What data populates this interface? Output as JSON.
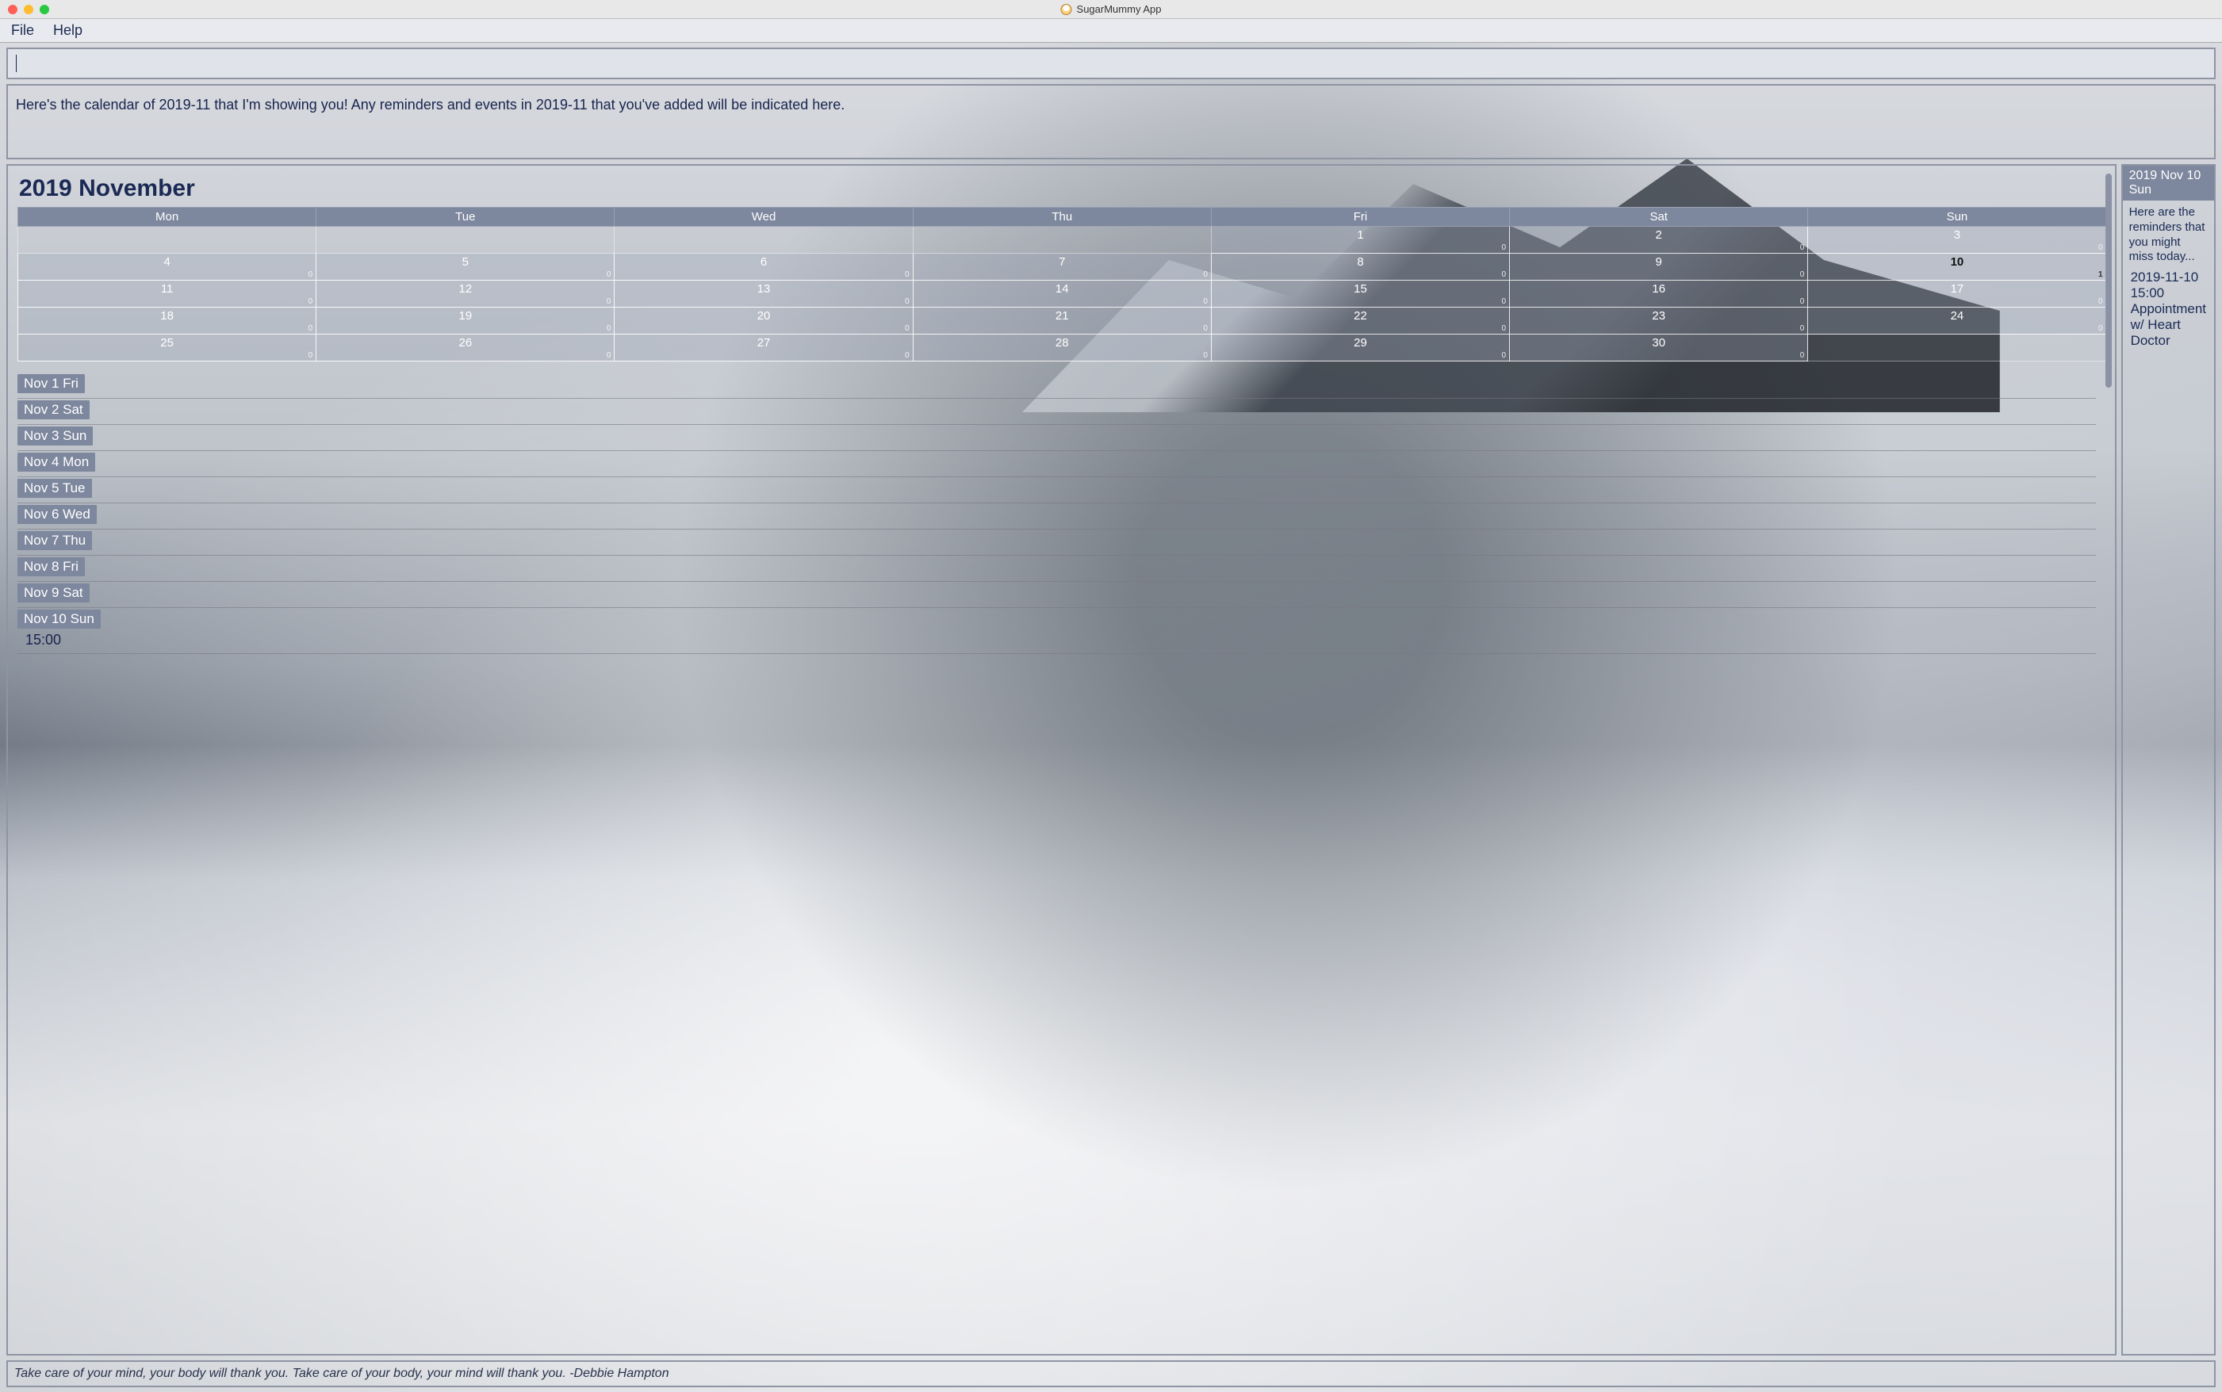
{
  "window": {
    "title": "SugarMummy App"
  },
  "menubar": {
    "file": "File",
    "help": "Help"
  },
  "command_input": {
    "value": ""
  },
  "message": "Here's the calendar of 2019-11 that I'm showing you! Any reminders and events in 2019-11 that you've added will be indicated here.",
  "calendar": {
    "title": "2019 November",
    "headers": [
      "Mon",
      "Tue",
      "Wed",
      "Thu",
      "Fri",
      "Sat",
      "Sun"
    ],
    "today": 10,
    "weeks": [
      [
        {
          "d": null
        },
        {
          "d": null
        },
        {
          "d": null
        },
        {
          "d": null
        },
        {
          "d": 1,
          "c": 0
        },
        {
          "d": 2,
          "c": 0
        },
        {
          "d": 3,
          "c": 0
        }
      ],
      [
        {
          "d": 4,
          "c": 0
        },
        {
          "d": 5,
          "c": 0
        },
        {
          "d": 6,
          "c": 0
        },
        {
          "d": 7,
          "c": 0
        },
        {
          "d": 8,
          "c": 0
        },
        {
          "d": 9,
          "c": 0
        },
        {
          "d": 10,
          "c": 1
        }
      ],
      [
        {
          "d": 11,
          "c": 0
        },
        {
          "d": 12,
          "c": 0
        },
        {
          "d": 13,
          "c": 0
        },
        {
          "d": 14,
          "c": 0
        },
        {
          "d": 15,
          "c": 0
        },
        {
          "d": 16,
          "c": 0
        },
        {
          "d": 17,
          "c": 0
        }
      ],
      [
        {
          "d": 18,
          "c": 0
        },
        {
          "d": 19,
          "c": 0
        },
        {
          "d": 20,
          "c": 0
        },
        {
          "d": 21,
          "c": 0
        },
        {
          "d": 22,
          "c": 0
        },
        {
          "d": 23,
          "c": 0
        },
        {
          "d": 24,
          "c": 0
        }
      ],
      [
        {
          "d": 25,
          "c": 0
        },
        {
          "d": 26,
          "c": 0
        },
        {
          "d": 27,
          "c": 0
        },
        {
          "d": 28,
          "c": 0
        },
        {
          "d": 29,
          "c": 0
        },
        {
          "d": 30,
          "c": 0
        },
        {
          "d": null
        }
      ]
    ]
  },
  "day_list": [
    {
      "label": "Nov 1 Fri",
      "events": []
    },
    {
      "label": "Nov 2 Sat",
      "events": []
    },
    {
      "label": "Nov 3 Sun",
      "events": []
    },
    {
      "label": "Nov 4 Mon",
      "events": []
    },
    {
      "label": "Nov 5 Tue",
      "events": []
    },
    {
      "label": "Nov 6 Wed",
      "events": []
    },
    {
      "label": "Nov 7 Thu",
      "events": []
    },
    {
      "label": "Nov 8 Fri",
      "events": []
    },
    {
      "label": "Nov 9 Sat",
      "events": []
    },
    {
      "label": "Nov 10 Sun",
      "events": [
        "15:00"
      ]
    }
  ],
  "side": {
    "header": "2019 Nov 10 Sun",
    "note": "Here are the reminders that you might miss today...",
    "items": [
      {
        "time": "2019-11-10 15:00",
        "desc": "Appointment w/ Heart Doctor"
      }
    ]
  },
  "footer": "Take care of your mind, your body will thank you. Take care of your body, your mind will thank you. -Debbie Hampton"
}
